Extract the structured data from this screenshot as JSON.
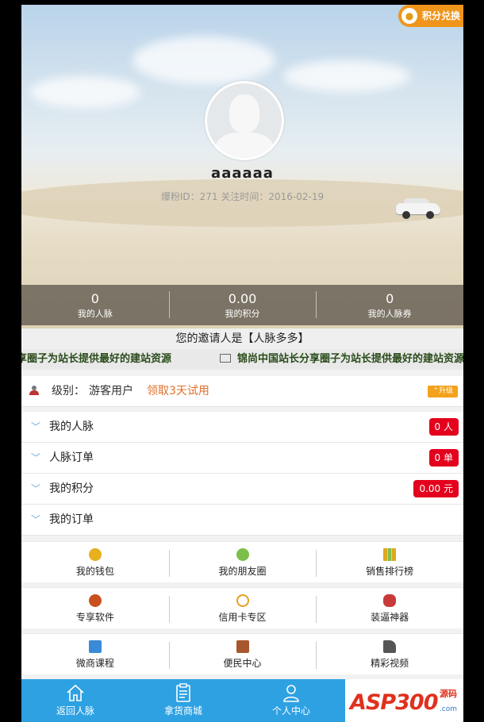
{
  "header": {
    "points_exchange_label": "积分兑换",
    "username": "aaaaaa",
    "user_id_line": "爆粉ID：271  关注时间：2016-02-19"
  },
  "stats": [
    {
      "value": "0",
      "label": "我的人脉"
    },
    {
      "value": "0.00",
      "label": "我的积分"
    },
    {
      "value": "0",
      "label": "我的人脉券"
    }
  ],
  "inviter": "您的邀请人是【人脉多多】",
  "marquee": {
    "text_left": "享圈子为站长提供最好的建站资源",
    "text_right": "锦尚中国站长分享圈子为站长提供最好的建站资源"
  },
  "level": {
    "label": "级别：",
    "value": "游客用户",
    "trial_link": "领取3天试用",
    "upgrade_label": "升级"
  },
  "menu": [
    {
      "label": "我的人脉",
      "badge": "0 人"
    },
    {
      "label": "人脉订单",
      "badge": "0 单"
    },
    {
      "label": "我的积分",
      "badge": "0.00 元"
    },
    {
      "label": "我的订单",
      "badge": ""
    }
  ],
  "grid": [
    [
      {
        "label": "我的钱包",
        "icon": "wallet-icon",
        "color": "#e6b01e"
      },
      {
        "label": "我的朋友圈",
        "icon": "friends-icon",
        "color": "#7cbf4a"
      },
      {
        "label": "销售排行榜",
        "icon": "ranking-icon",
        "color": "#e0a820"
      }
    ],
    [
      {
        "label": "专享软件",
        "icon": "software-icon",
        "color": "#c8511e"
      },
      {
        "label": "信用卡专区",
        "icon": "credit-card-icon",
        "color": "#e6a01e"
      },
      {
        "label": "装逼神器",
        "icon": "mask-icon",
        "color": "#c83a3a"
      }
    ],
    [
      {
        "label": "微商课程",
        "icon": "course-icon",
        "color": "#3a8ad6"
      },
      {
        "label": "便民中心",
        "icon": "service-icon",
        "color": "#a8562e"
      },
      {
        "label": "精彩视频",
        "icon": "video-icon",
        "color": "#555555"
      }
    ]
  ],
  "tabbar": [
    {
      "label": "返回人脉",
      "icon": "home-icon"
    },
    {
      "label": "拿货商城",
      "icon": "clipboard-icon"
    },
    {
      "label": "个人中心",
      "icon": "user-icon"
    }
  ],
  "watermark": {
    "main": "ASP300",
    "side_top": "源码",
    "side_bottom": ".com"
  },
  "colors": {
    "tabbar": "#2ea1e2",
    "badge": "#e4001d",
    "points_button": "#f0951b",
    "upgrade": "#f3a21c"
  }
}
